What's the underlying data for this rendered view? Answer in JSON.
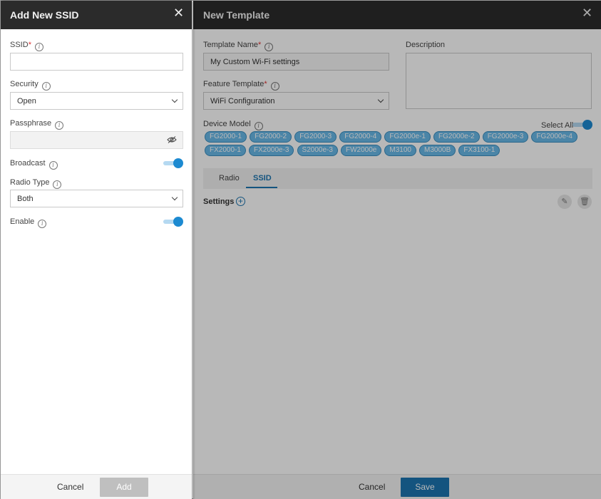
{
  "template_panel": {
    "title": "New Template",
    "template_name_label": "Template Name",
    "template_name_value": "My Custom Wi-Fi settings",
    "description_label": "Description",
    "feature_template_label": "Feature Template",
    "feature_template_value": "WiFi Configuration",
    "device_model_label": "Device Model",
    "select_all_label": "Select All",
    "device_models": [
      "FG2000-1",
      "FG2000-2",
      "FG2000-3",
      "FG2000-4",
      "FG2000e-1",
      "FG2000e-2",
      "FG2000e-3",
      "FG2000e-4",
      "FX2000-1",
      "FX2000e-3",
      "S2000e-3",
      "FW2000e",
      "M3100",
      "M3000B",
      "FX3100-1"
    ],
    "tabs": [
      "Radio",
      "SSID"
    ],
    "active_tab": "SSID",
    "settings_label": "Settings",
    "cancel_label": "Cancel",
    "save_label": "Save"
  },
  "ssid_panel": {
    "title": "Add New SSID",
    "ssid_label": "SSID",
    "ssid_value": "",
    "security_label": "Security",
    "security_value": "Open",
    "passphrase_label": "Passphrase",
    "passphrase_value": "",
    "broadcast_label": "Broadcast",
    "broadcast_on": true,
    "radio_type_label": "Radio Type",
    "radio_type_value": "Both",
    "enable_label": "Enable",
    "enable_on": true,
    "cancel_label": "Cancel",
    "add_label": "Add"
  },
  "colors": {
    "accent": "#1c75b0",
    "header_bg": "#2b2b2b",
    "chip_bg": "#69b9e8",
    "toggle_knob": "#1c8ad1"
  },
  "icons": [
    "close-icon",
    "info-icon",
    "chevron-down-icon",
    "eye-slash-icon",
    "plus-circle-icon",
    "pencil-icon",
    "trash-icon"
  ]
}
